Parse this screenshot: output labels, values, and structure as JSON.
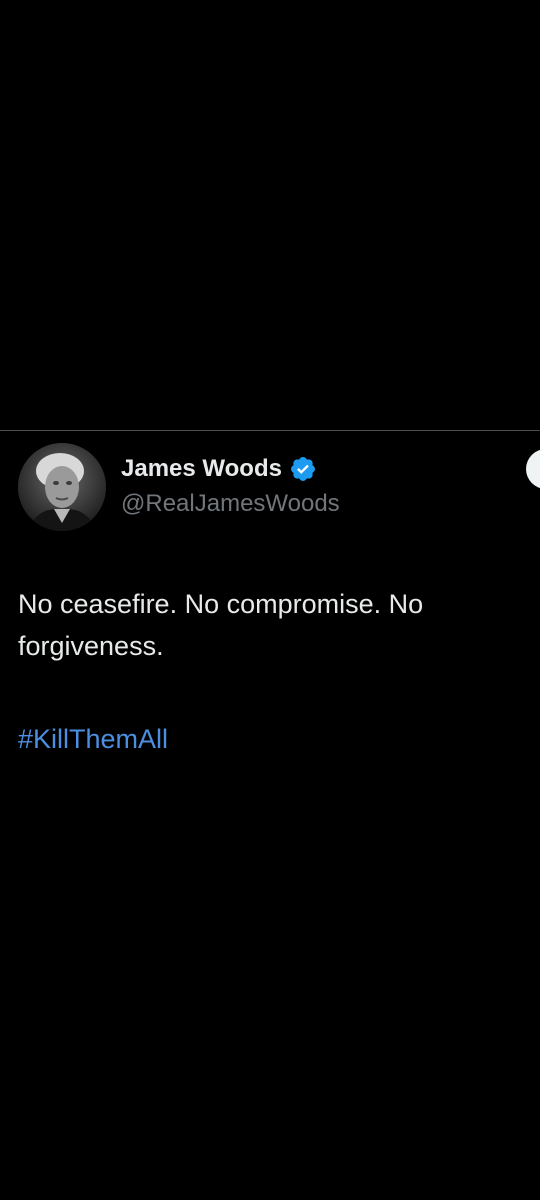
{
  "tweet": {
    "author": {
      "display_name": "James Woods",
      "handle": "@RealJamesWoods",
      "verified_icon": "verified-badge-icon",
      "avatar": "grayscale portrait photo"
    },
    "text": "No ceasefire. No compromise. No forgiveness.",
    "hashtag": "#KillThemAll"
  },
  "colors": {
    "background": "#000000",
    "text": "#e7e9ea",
    "secondary_text": "#71767b",
    "link": "#4c8fe0",
    "verified": "#1d9bf0",
    "divider": "#4a4d50"
  }
}
